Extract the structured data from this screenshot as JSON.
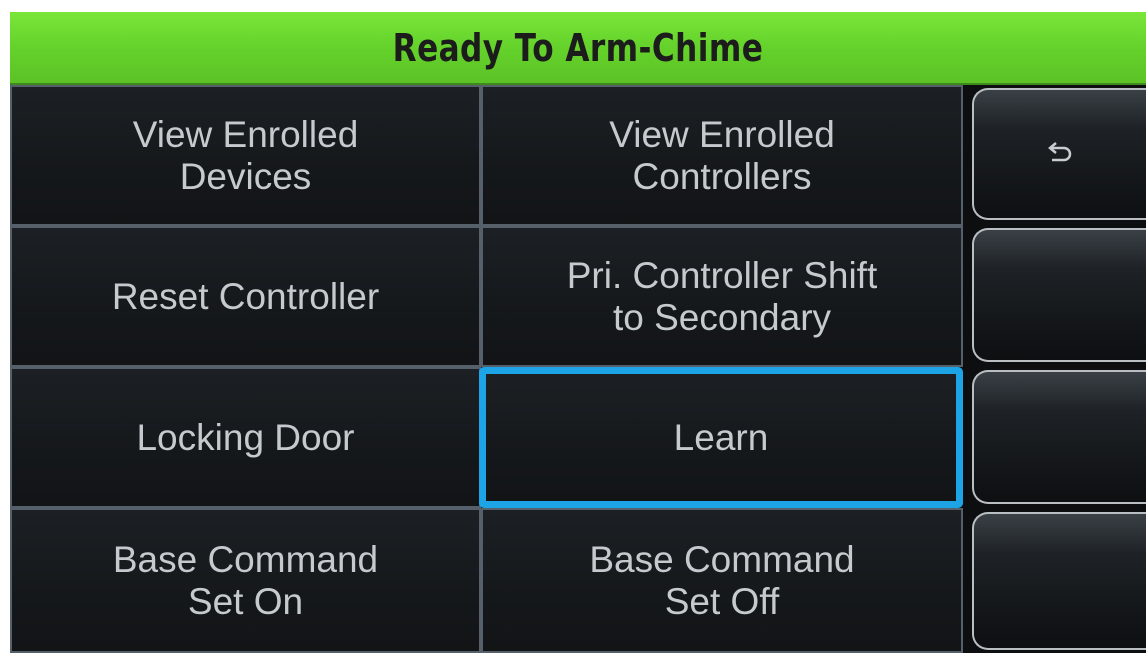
{
  "status_bar": {
    "title": "Ready To Arm-Chime",
    "color": "#66d42c"
  },
  "menu": {
    "items": [
      {
        "label": "View Enrolled\nDevices",
        "selected": false
      },
      {
        "label": "View Enrolled\nControllers",
        "selected": false
      },
      {
        "label": "Reset Controller",
        "selected": false
      },
      {
        "label": "Pri. Controller Shift\nto Secondary",
        "selected": false
      },
      {
        "label": "Locking Door",
        "selected": false
      },
      {
        "label": "Learn",
        "selected": true
      },
      {
        "label": "Base Command\nSet On",
        "selected": false
      },
      {
        "label": "Base Command\nSet Off",
        "selected": false
      }
    ],
    "selection_color": "#1da4e6"
  },
  "side_buttons": [
    {
      "icon": "back-arrow-icon"
    },
    {
      "icon": ""
    },
    {
      "icon": ""
    },
    {
      "icon": ""
    }
  ]
}
